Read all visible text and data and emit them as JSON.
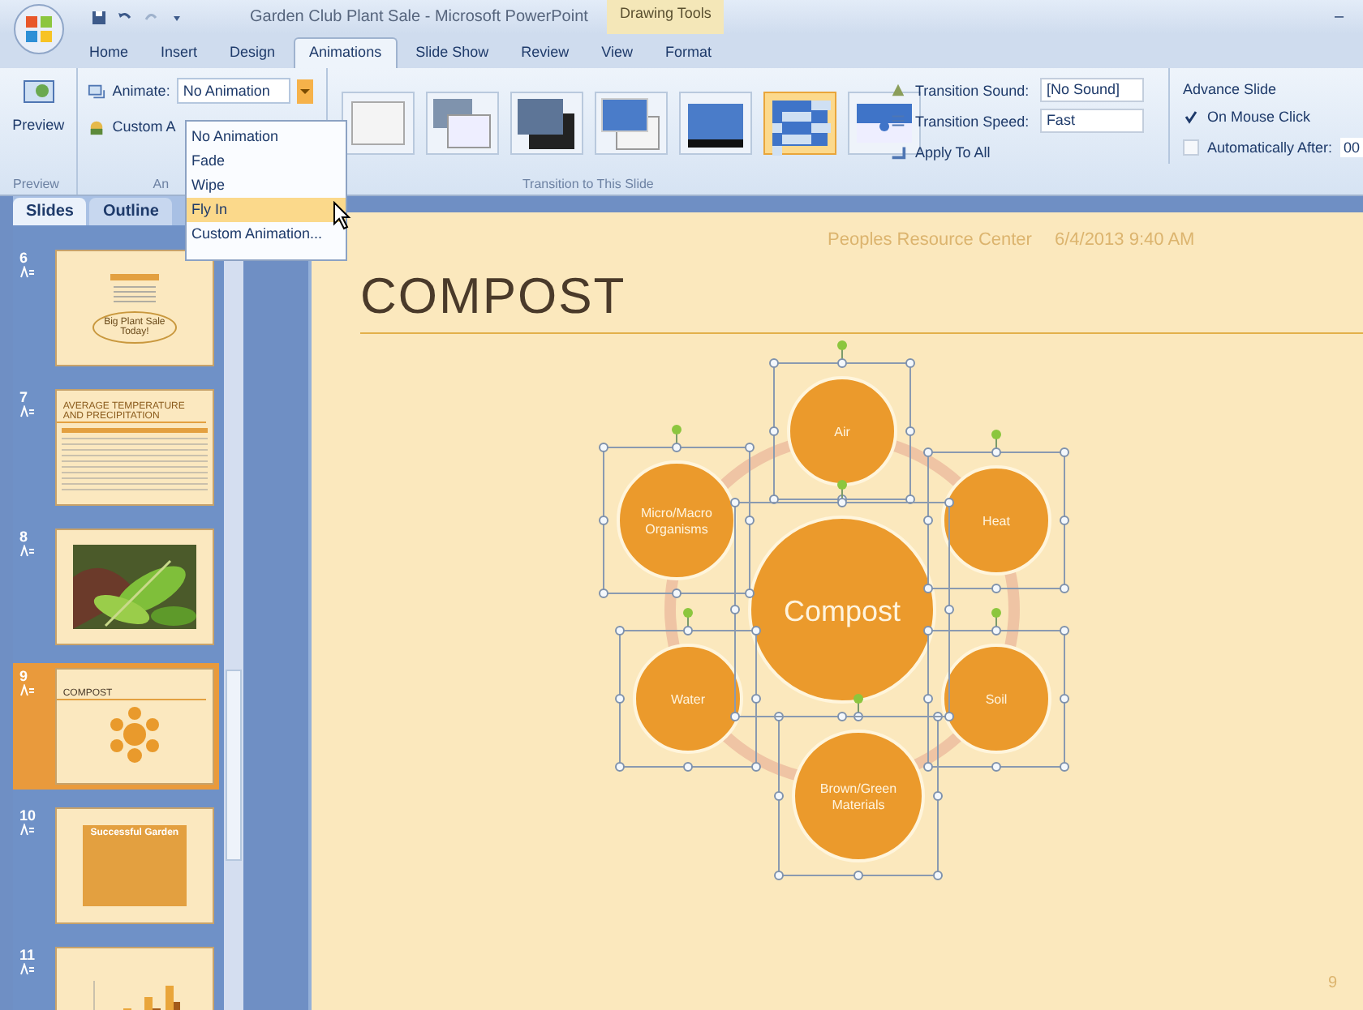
{
  "window": {
    "title": "Garden Club Plant Sale - Microsoft PowerPoint",
    "contextual_tab": "Drawing Tools",
    "minimize": "–"
  },
  "ribbon_tabs": [
    {
      "label": "Home",
      "selected": false
    },
    {
      "label": "Insert",
      "selected": false
    },
    {
      "label": "Design",
      "selected": false
    },
    {
      "label": "Animations",
      "selected": true
    },
    {
      "label": "Slide Show",
      "selected": false
    },
    {
      "label": "Review",
      "selected": false
    },
    {
      "label": "View",
      "selected": false
    },
    {
      "label": "Format",
      "selected": false
    }
  ],
  "ribbon": {
    "preview": {
      "button": "Preview",
      "group_label": "Preview"
    },
    "animations": {
      "animate_label": "Animate:",
      "animate_value": "No Animation",
      "custom_button": "Custom A",
      "group_label": "An"
    },
    "transitions": {
      "thumbnails": [
        {
          "kind": "blank",
          "selected": false
        },
        {
          "kind": "stacked",
          "selected": false
        },
        {
          "kind": "stacked-dark",
          "selected": false
        },
        {
          "kind": "shifted",
          "selected": false
        },
        {
          "kind": "shadow",
          "selected": false
        },
        {
          "kind": "checker",
          "selected": true
        },
        {
          "kind": "split",
          "selected": false
        }
      ],
      "sound_label": "Transition Sound:",
      "sound_value": "[No Sound]",
      "speed_label": "Transition Speed:",
      "speed_value": "Fast",
      "apply_all": "Apply To All",
      "group_label": "Transition to This Slide"
    },
    "advance": {
      "title": "Advance Slide",
      "options": [
        {
          "label": "On Mouse Click",
          "checked": true
        },
        {
          "label": "Automatically After:",
          "checked": false
        }
      ],
      "time": "00"
    }
  },
  "animate_menu": {
    "items": [
      {
        "label": "No Animation",
        "selected": false
      },
      {
        "label": "Fade",
        "selected": false
      },
      {
        "label": "Wipe",
        "selected": false
      },
      {
        "label": "Fly In",
        "selected": true
      },
      {
        "label": "Custom Animation...",
        "selected": false
      }
    ]
  },
  "panel": {
    "tabs": [
      {
        "label": "Slides",
        "selected": true
      },
      {
        "label": "Outline",
        "selected": false
      }
    ],
    "slides": [
      {
        "number": "6",
        "kind": "sale",
        "text": "Big Plant Sale Today!",
        "selected": false
      },
      {
        "number": "7",
        "kind": "table",
        "text": "AVERAGE TEMPERATURE AND PRECIPITATION",
        "selected": false
      },
      {
        "number": "8",
        "selected": false
      },
      {
        "number": "9",
        "kind": "diagram",
        "text": "COMPOST",
        "selected": true
      },
      {
        "number": "10",
        "kind": "banner",
        "text": "Successful Garden",
        "selected": false
      },
      {
        "number": "11",
        "kind": "chart",
        "selected": false
      }
    ]
  },
  "slide": {
    "header": "Peoples Resource Center",
    "date": "6/4/2013 9:40 AM",
    "title": "COMPOST",
    "page_number": "9",
    "diagram": {
      "center": "Compost",
      "nodes": [
        {
          "lines": [
            "Air"
          ]
        },
        {
          "lines": [
            "Heat"
          ]
        },
        {
          "lines": [
            "Soil"
          ]
        },
        {
          "lines": [
            "Brown/Green",
            "Materials"
          ]
        },
        {
          "lines": [
            "Water"
          ]
        },
        {
          "lines": [
            "Micro/Macro",
            "Organisms"
          ]
        }
      ]
    }
  }
}
